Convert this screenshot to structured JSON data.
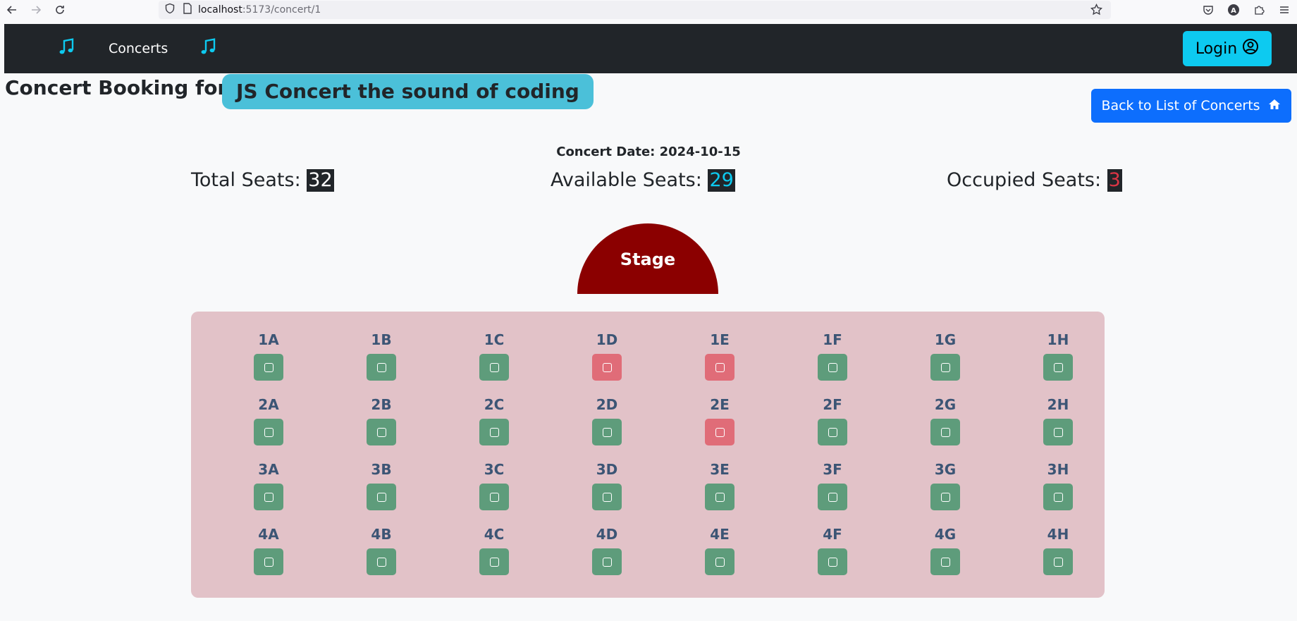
{
  "browser": {
    "url_host": "localhost",
    "url_rest": ":5173/concert/1"
  },
  "navbar": {
    "concerts_label": "Concerts",
    "login_label": "Login"
  },
  "header": {
    "title_prefix": "Concert Booking for:",
    "concert_name": "JS Concert the sound of coding",
    "back_label": "Back to List of Concerts"
  },
  "details": {
    "date_text": "Concert Date: 2024-10-15"
  },
  "stats": {
    "total_label": "Total Seats:",
    "total_value": "32",
    "available_label": "Available Seats:",
    "available_value": "29",
    "occupied_label": "Occupied Seats:",
    "occupied_value": "3"
  },
  "stage": {
    "label": "Stage"
  },
  "seats": [
    {
      "label": "1A",
      "status": "free"
    },
    {
      "label": "1B",
      "status": "free"
    },
    {
      "label": "1C",
      "status": "free"
    },
    {
      "label": "1D",
      "status": "occupied"
    },
    {
      "label": "1E",
      "status": "occupied"
    },
    {
      "label": "1F",
      "status": "free"
    },
    {
      "label": "1G",
      "status": "free"
    },
    {
      "label": "1H",
      "status": "free"
    },
    {
      "label": "2A",
      "status": "free"
    },
    {
      "label": "2B",
      "status": "free"
    },
    {
      "label": "2C",
      "status": "free"
    },
    {
      "label": "2D",
      "status": "free"
    },
    {
      "label": "2E",
      "status": "occupied"
    },
    {
      "label": "2F",
      "status": "free"
    },
    {
      "label": "2G",
      "status": "free"
    },
    {
      "label": "2H",
      "status": "free"
    },
    {
      "label": "3A",
      "status": "free"
    },
    {
      "label": "3B",
      "status": "free"
    },
    {
      "label": "3C",
      "status": "free"
    },
    {
      "label": "3D",
      "status": "free"
    },
    {
      "label": "3E",
      "status": "free"
    },
    {
      "label": "3F",
      "status": "free"
    },
    {
      "label": "3G",
      "status": "free"
    },
    {
      "label": "3H",
      "status": "free"
    },
    {
      "label": "4A",
      "status": "free"
    },
    {
      "label": "4B",
      "status": "free"
    },
    {
      "label": "4C",
      "status": "free"
    },
    {
      "label": "4D",
      "status": "free"
    },
    {
      "label": "4E",
      "status": "free"
    },
    {
      "label": "4F",
      "status": "free"
    },
    {
      "label": "4G",
      "status": "free"
    },
    {
      "label": "4H",
      "status": "free"
    }
  ],
  "colors": {
    "navbar_bg": "#212529",
    "accent_info": "#0dcaf0",
    "primary": "#0d6efd",
    "stage": "#8b0000",
    "seat_free": "#5e9c7b",
    "seat_occupied": "#e06c78",
    "seat_area_bg": "#e2c2c8"
  },
  "icons": {
    "brand": "music-note-icon",
    "login": "person-circle-icon",
    "back": "house-icon"
  }
}
